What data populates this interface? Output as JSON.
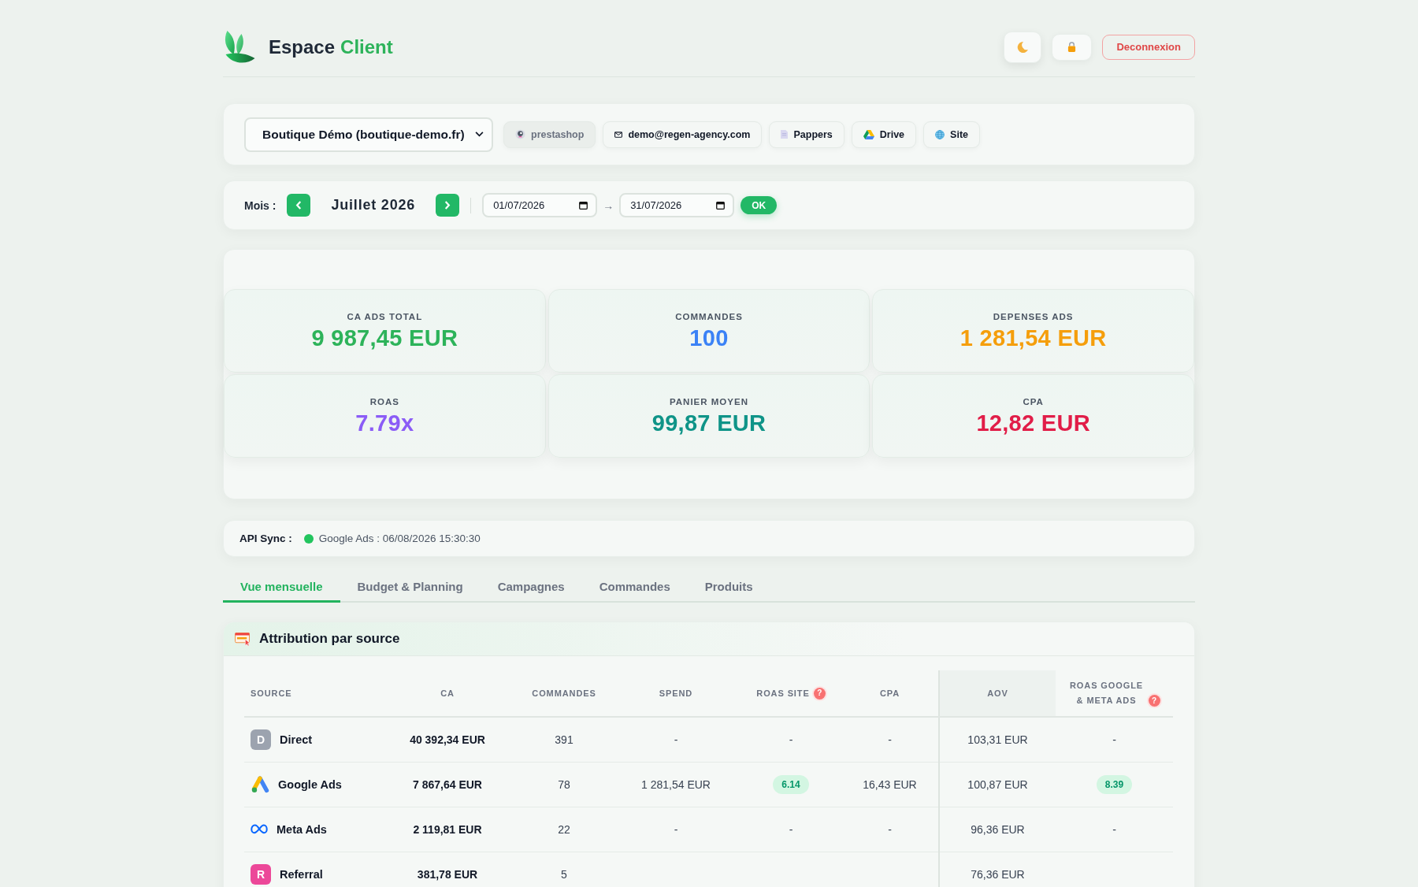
{
  "header": {
    "brand": {
      "name": "Espace",
      "accent": "Client"
    },
    "logout": "Deconnexion"
  },
  "shop_bar": {
    "select": {
      "value": "Boutique Démo (boutique-demo.fr)"
    },
    "links": [
      {
        "kind": "prestashop",
        "label": "prestashop",
        "disabled": true
      },
      {
        "kind": "email",
        "label": "demo@regen-agency.com",
        "disabled": false
      },
      {
        "kind": "document",
        "label": "Pappers",
        "disabled": false
      },
      {
        "kind": "drive",
        "label": "Drive",
        "disabled": false
      },
      {
        "kind": "globe",
        "label": "Site",
        "disabled": false
      }
    ]
  },
  "period_bar": {
    "label": "Mois :",
    "month": "Juillet 2026",
    "start": "01/07/2026",
    "arrow": "→",
    "end": "31/07/2026",
    "submit": "OK"
  },
  "kpis": [
    {
      "label": "CA ADS TOTAL",
      "value": "9 987,45 EUR",
      "color": "#2db35a"
    },
    {
      "label": "COMMANDES",
      "value": "100",
      "color": "#3b82f6"
    },
    {
      "label": "DEPENSES ADS",
      "value": "1 281,54 EUR",
      "color": "#f59e0b"
    },
    {
      "label": "ROAS",
      "value": "7.79x",
      "color": "#8b5cf6"
    },
    {
      "label": "PANIER MOYEN",
      "value": "99,87 EUR",
      "color": "#0f9488"
    },
    {
      "label": "CPA",
      "value": "12,82 EUR",
      "color": "#e11d48"
    }
  ],
  "sync": {
    "label": "API Sync :",
    "items": [
      {
        "text": "Google Ads : 06/08/2026 15:30:30",
        "color": "#22c55e"
      }
    ]
  },
  "tabs": [
    {
      "label": "Vue mensuelle",
      "selected": true
    },
    {
      "label": "Budget & Planning",
      "selected": false
    },
    {
      "label": "Campagnes",
      "selected": false
    },
    {
      "label": "Commandes",
      "selected": false
    },
    {
      "label": "Produits",
      "selected": false
    }
  ],
  "attribution": {
    "title": "Attribution par source",
    "columns": [
      {
        "label": "SOURCE"
      },
      {
        "label": "CA"
      },
      {
        "label": "COMMANDES"
      },
      {
        "label": "SPEND"
      },
      {
        "label": "ROAS SITE",
        "help": "?"
      },
      {
        "label": "CPA"
      },
      {
        "label": "AOV"
      },
      {
        "label": "ROAS GOOGLE & META ADS",
        "help": "?"
      }
    ],
    "rows": [
      {
        "kind": "letter",
        "badge": "D",
        "color": "#9ca3af",
        "source": "Direct",
        "ca": "40 392,34 EUR",
        "commandes": "391",
        "spend": "-",
        "roas_site": {
          "text": "-",
          "pill": false
        },
        "cpa": "-",
        "aov": "103,31 EUR",
        "roas_google_meta_ads": {
          "text": "-",
          "pill": false
        }
      },
      {
        "kind": "google",
        "source": "Google Ads",
        "ca": "7 867,64 EUR",
        "commandes": "78",
        "spend": "1 281,54 EUR",
        "roas_site": {
          "text": "6.14",
          "pill": true
        },
        "cpa": "16,43 EUR",
        "aov": "100,87 EUR",
        "roas_google_meta_ads": {
          "text": "8.39",
          "pill": true
        }
      },
      {
        "kind": "meta",
        "source": "Meta Ads",
        "ca": "2 119,81 EUR",
        "commandes": "22",
        "spend": "-",
        "roas_site": {
          "text": "-",
          "pill": false
        },
        "cpa": "-",
        "aov": "96,36 EUR",
        "roas_google_meta_ads": {
          "text": "-",
          "pill": false
        }
      },
      {
        "kind": "letter",
        "badge": "R",
        "color": "#ec4899",
        "source": "Referral",
        "ca": "381,78 EUR",
        "commandes": "5",
        "aov": "76,36 EUR"
      }
    ]
  }
}
